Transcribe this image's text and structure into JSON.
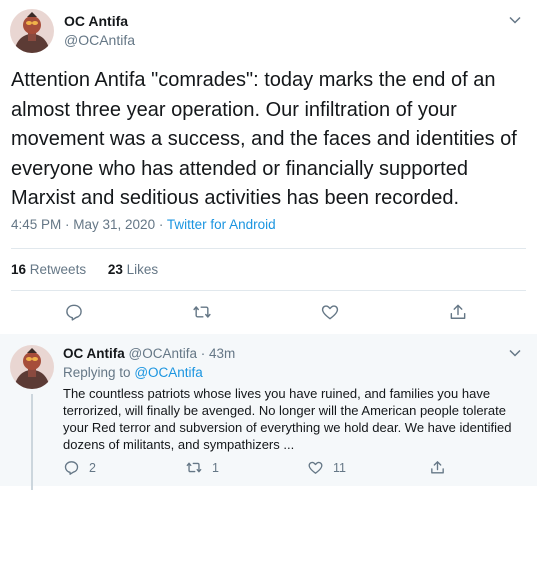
{
  "main_tweet": {
    "display_name": "OC Antifa",
    "handle": "@OCAntifa",
    "text": "Attention Antifa \"comrades\": today marks the end of an almost three year operation. Our infiltration of your movement was a success, and the faces and identities of everyone who has attended or financially supported Marxist and seditious activities has been recorded.",
    "time": "4:45 PM · May 31, 2020 · ",
    "source": "Twitter for Android",
    "retweets_count": "16",
    "retweets_label": "Retweets",
    "likes_count": "23",
    "likes_label": "Likes"
  },
  "reply_tweet": {
    "display_name": "OC Antifa",
    "handle_time": "@OCAntifa · 43m",
    "replying_prefix": "Replying to",
    "replying_to": "@OCAntifa",
    "text": "The countless patriots whose lives you have ruined, and families you have terrorized, will finally be avenged. No longer will the American people tolerate your Red terror and subversion of everything we hold dear. We have identified dozens of militants,  and sympathizers ...",
    "reply_count": "2",
    "retweet_count": "1",
    "like_count": "11"
  },
  "icons": [
    "avatar-icon",
    "chevron-down-icon",
    "reply-icon",
    "retweet-icon",
    "like-icon",
    "share-icon"
  ],
  "colors": {
    "accent": "#1b95e0",
    "muted": "#657786",
    "text": "#14171a",
    "divider": "#e1e8ed",
    "reply_bg": "#f5f8fa"
  }
}
